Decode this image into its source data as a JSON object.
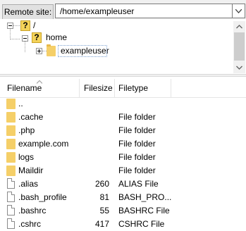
{
  "site_bar": {
    "label": "Remote site:",
    "path": "/home/exampleuser"
  },
  "tree": {
    "nodes": [
      {
        "label": "/"
      },
      {
        "label": "home"
      },
      {
        "label": "exampleuser"
      }
    ]
  },
  "list": {
    "columns": {
      "name": "Filename",
      "size": "Filesize",
      "type": "Filetype"
    },
    "rows": [
      {
        "name": "..",
        "size": "",
        "type": "",
        "icon": "folder-icon"
      },
      {
        "name": ".cache",
        "size": "",
        "type": "File folder",
        "icon": "folder-icon"
      },
      {
        "name": ".php",
        "size": "",
        "type": "File folder",
        "icon": "folder-icon"
      },
      {
        "name": "example.com",
        "size": "",
        "type": "File folder",
        "icon": "folder-icon"
      },
      {
        "name": "logs",
        "size": "",
        "type": "File folder",
        "icon": "folder-icon"
      },
      {
        "name": "Maildir",
        "size": "",
        "type": "File folder",
        "icon": "folder-icon"
      },
      {
        "name": ".alias",
        "size": "260",
        "type": "ALIAS File",
        "icon": "file-icon"
      },
      {
        "name": ".bash_profile",
        "size": "81",
        "type": "BASH_PRO...",
        "icon": "file-icon"
      },
      {
        "name": ".bashrc",
        "size": "55",
        "type": "BASHRC File",
        "icon": "file-icon"
      },
      {
        "name": ".cshrc",
        "size": "417",
        "type": "CSHRC File",
        "icon": "file-icon"
      }
    ]
  },
  "colors": {
    "folder": "#f5cf68",
    "question": "#f4d35a",
    "selection": "#7aa0d0"
  }
}
